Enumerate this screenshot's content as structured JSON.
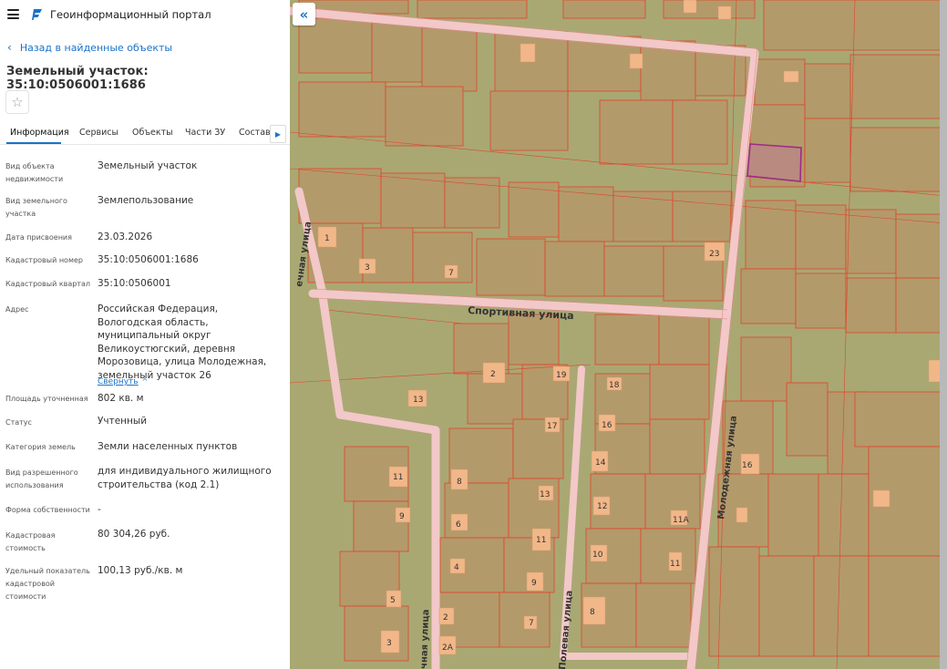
{
  "app": {
    "title": "Геоинформационный портал",
    "menu_icon": "menu-icon",
    "logo_icon": "portal-logo-icon"
  },
  "nav": {
    "back_label": "Назад в найденные объекты"
  },
  "object": {
    "title": "Земельный участок: 35:10:0506001:1686"
  },
  "tabs": [
    {
      "label": "Информация",
      "active": true
    },
    {
      "label": "Сервисы"
    },
    {
      "label": "Объекты"
    },
    {
      "label": "Части ЗУ"
    },
    {
      "label": "Состав"
    }
  ],
  "info": {
    "rows": [
      {
        "label": "Вид объекта недвижимости",
        "value": "Земельный участок"
      },
      {
        "label": "Вид земельного участка",
        "value": "Землепользование"
      },
      {
        "label": "Дата присвоения",
        "value": "23.03.2026"
      },
      {
        "label": "Кадастровый номер",
        "value": "35:10:0506001:1686"
      },
      {
        "label": "Кадастровый квартал",
        "value": "35:10:0506001"
      },
      {
        "label": "Адрес",
        "value": "Российская Федерация, Вологодская область, муниципальный округ Великоустюгский, деревня Морозовица, улица Молодежная, земельный участок 26"
      },
      {
        "label": "Площадь уточненная",
        "value": "802 кв. м"
      },
      {
        "label": "Статус",
        "value": "Учтенный"
      },
      {
        "label": "Категория земель",
        "value": "Земли населенных пунктов"
      },
      {
        "label": "Вид разрешенного использования",
        "value": "для индивидуального жилищного строительства (код 2.1)"
      },
      {
        "label": "Форма собственности",
        "value": "-"
      },
      {
        "label": "Кадастровая стоимость",
        "value": "80 304,26 руб."
      },
      {
        "label": "Удельный показатель кадастровой стоимости",
        "value": "100,13 руб./кв. м"
      }
    ],
    "collapse_label": "Свернуть"
  },
  "map": {
    "streets": [
      "Спортивная улица",
      "Молодежная улица",
      "Полевая улица",
      "ечная улица",
      "чная улица"
    ],
    "house_numbers": [
      "1",
      "3",
      "7",
      "23",
      "2",
      "19",
      "18",
      "13",
      "17",
      "16",
      "14",
      "16",
      "11",
      "8",
      "13",
      "12",
      "11А",
      "9",
      "6",
      "11",
      "10",
      "11",
      "4",
      "9",
      "8",
      "5",
      "2",
      "7",
      "3",
      "2А"
    ],
    "colors": {
      "land": "#a9a873",
      "parcel_fill": "#b39a6b",
      "boundary": "#e0452a",
      "road": "#f3c8c8",
      "building": "#f1b789",
      "selected": "#a02a86"
    }
  }
}
